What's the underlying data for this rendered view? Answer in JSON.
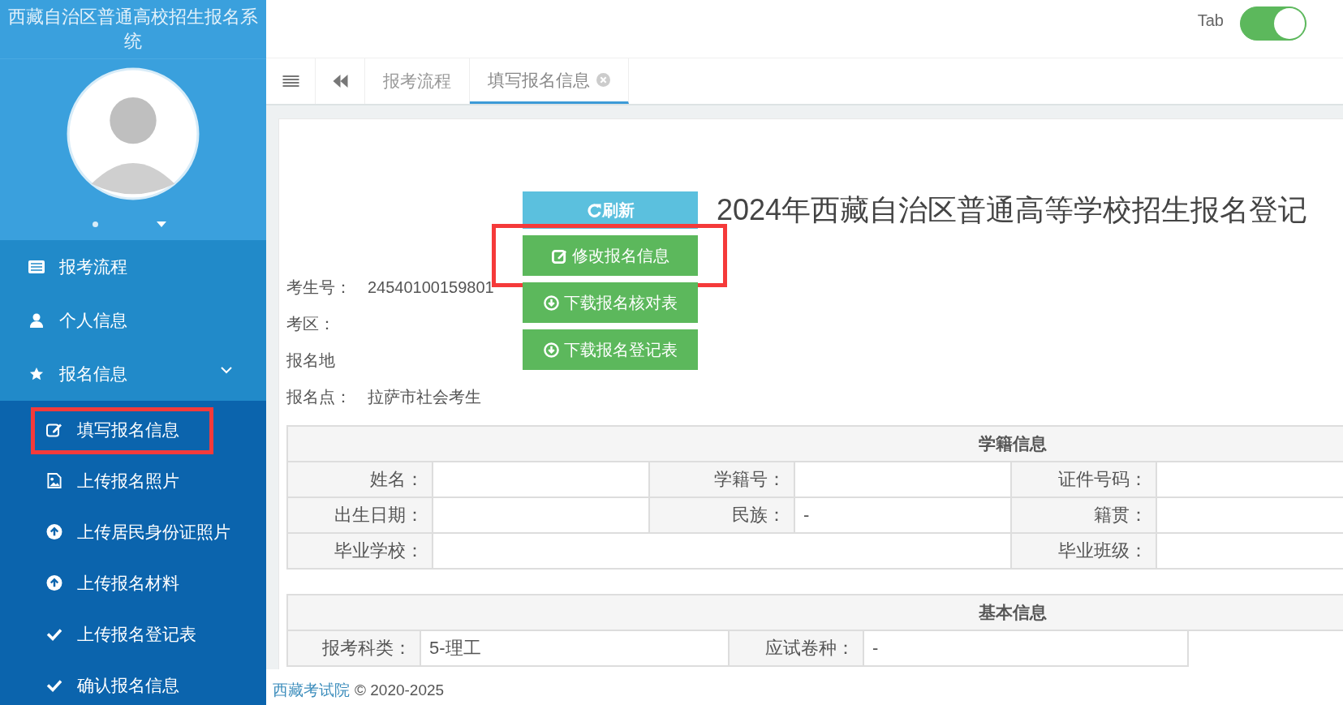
{
  "sidebar": {
    "title": "西藏自治区普通高校招生报名系统",
    "menu": [
      {
        "label": "报考流程"
      },
      {
        "label": "个人信息"
      },
      {
        "label": "报名信息",
        "expanded": true,
        "children": [
          {
            "label": "填写报名信息",
            "marked": true
          },
          {
            "label": "上传报名照片",
            "marked": false
          },
          {
            "label": "上传居民身份证照片",
            "marked": false
          },
          {
            "label": "上传报名材料",
            "marked": false
          },
          {
            "label": "上传报名登记表",
            "marked": false
          },
          {
            "label": "确认报名信息",
            "marked": false
          }
        ]
      }
    ]
  },
  "topbar": {
    "toggle": {
      "label": "Tab",
      "on": true
    }
  },
  "tabs": [
    {
      "label": "报考流程",
      "selected": false,
      "closable": false
    },
    {
      "label": "填写报名信息",
      "selected": true,
      "closable": true
    }
  ],
  "buttons": [
    {
      "label": "刷新",
      "kind": "info",
      "marked": false
    },
    {
      "label": "修改报名信息",
      "kind": "success",
      "marked": true
    },
    {
      "label": "下载报名核对表",
      "kind": "success",
      "marked": false
    },
    {
      "label": "下载报名登记表",
      "kind": "success",
      "marked": false
    }
  ],
  "form_title": "2024年西藏自治区普通高等学校招生报名登记",
  "info_rows": [
    {
      "label": "考生号：",
      "value": "24540100159801"
    },
    {
      "label": "考区："
    },
    {
      "label": "报名地"
    },
    {
      "label": "报名点：",
      "value": "拉萨市社会考生"
    }
  ],
  "sections": [
    {
      "title": "学籍信息",
      "rows": [
        [
          {
            "label": "姓名："
          },
          {
            "label": "学籍号："
          },
          {
            "label": "证件号码："
          }
        ],
        [
          {
            "label": "出生日期："
          },
          {
            "label": "民族：",
            "value": "-"
          },
          {
            "label": "籍贯："
          }
        ],
        [
          {
            "label": "毕业学校："
          },
          "",
          {
            "label": "毕业班级："
          }
        ]
      ]
    },
    {
      "title": "基本信息",
      "rows": [
        [
          {
            "label": "报考科类：",
            "value": "5-理工"
          },
          {
            "label": "应试卷种：",
            "value": "-"
          }
        ]
      ]
    }
  ],
  "footer": {
    "link": "西藏考试院",
    "text": "© 2020-2025"
  }
}
